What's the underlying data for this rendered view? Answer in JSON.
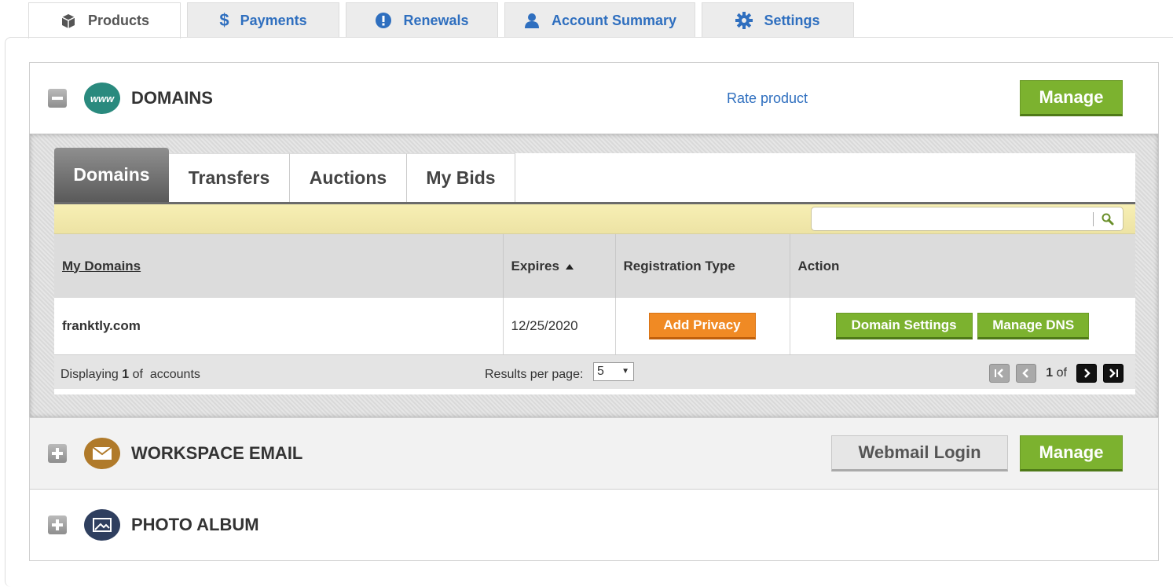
{
  "tabs": [
    {
      "label": "Products",
      "icon": "box-icon"
    },
    {
      "label": "Payments",
      "icon": "dollar-icon"
    },
    {
      "label": "Renewals",
      "icon": "alert-icon"
    },
    {
      "label": "Account Summary",
      "icon": "user-icon"
    },
    {
      "label": "Settings",
      "icon": "gear-icon"
    }
  ],
  "domains_product": {
    "title": "DOMAINS",
    "icon_text": "www",
    "rate_label": "Rate product",
    "manage_label": "Manage"
  },
  "subtabs": [
    "Domains",
    "Transfers",
    "Auctions",
    "My Bids"
  ],
  "table": {
    "columns": [
      "My Domains",
      "Expires",
      "Registration Type",
      "Action"
    ],
    "rows": [
      {
        "domain": "franktly.com",
        "expires": "12/25/2020",
        "registration_button": "Add Privacy",
        "action_buttons": [
          "Domain Settings",
          "Manage DNS"
        ]
      }
    ]
  },
  "footer": {
    "displaying_prefix": "Displaying",
    "displaying_count": "1",
    "displaying_suffix": "of  accounts",
    "results_label": "Results per page:",
    "results_value": "5",
    "page_current": "1",
    "page_of": "of"
  },
  "email_product": {
    "title": "WORKSPACE EMAIL",
    "webmail_label": "Webmail Login",
    "manage_label": "Manage"
  },
  "photo_product": {
    "title": "PHOTO ALBUM"
  },
  "colors": {
    "accent_blue": "#2f6fbf",
    "green": "#7cb22f",
    "orange": "#f08a24",
    "domains_icon": "#2a8a7e",
    "email_icon": "#b07a2a",
    "photo_icon": "#2f3f5f"
  }
}
